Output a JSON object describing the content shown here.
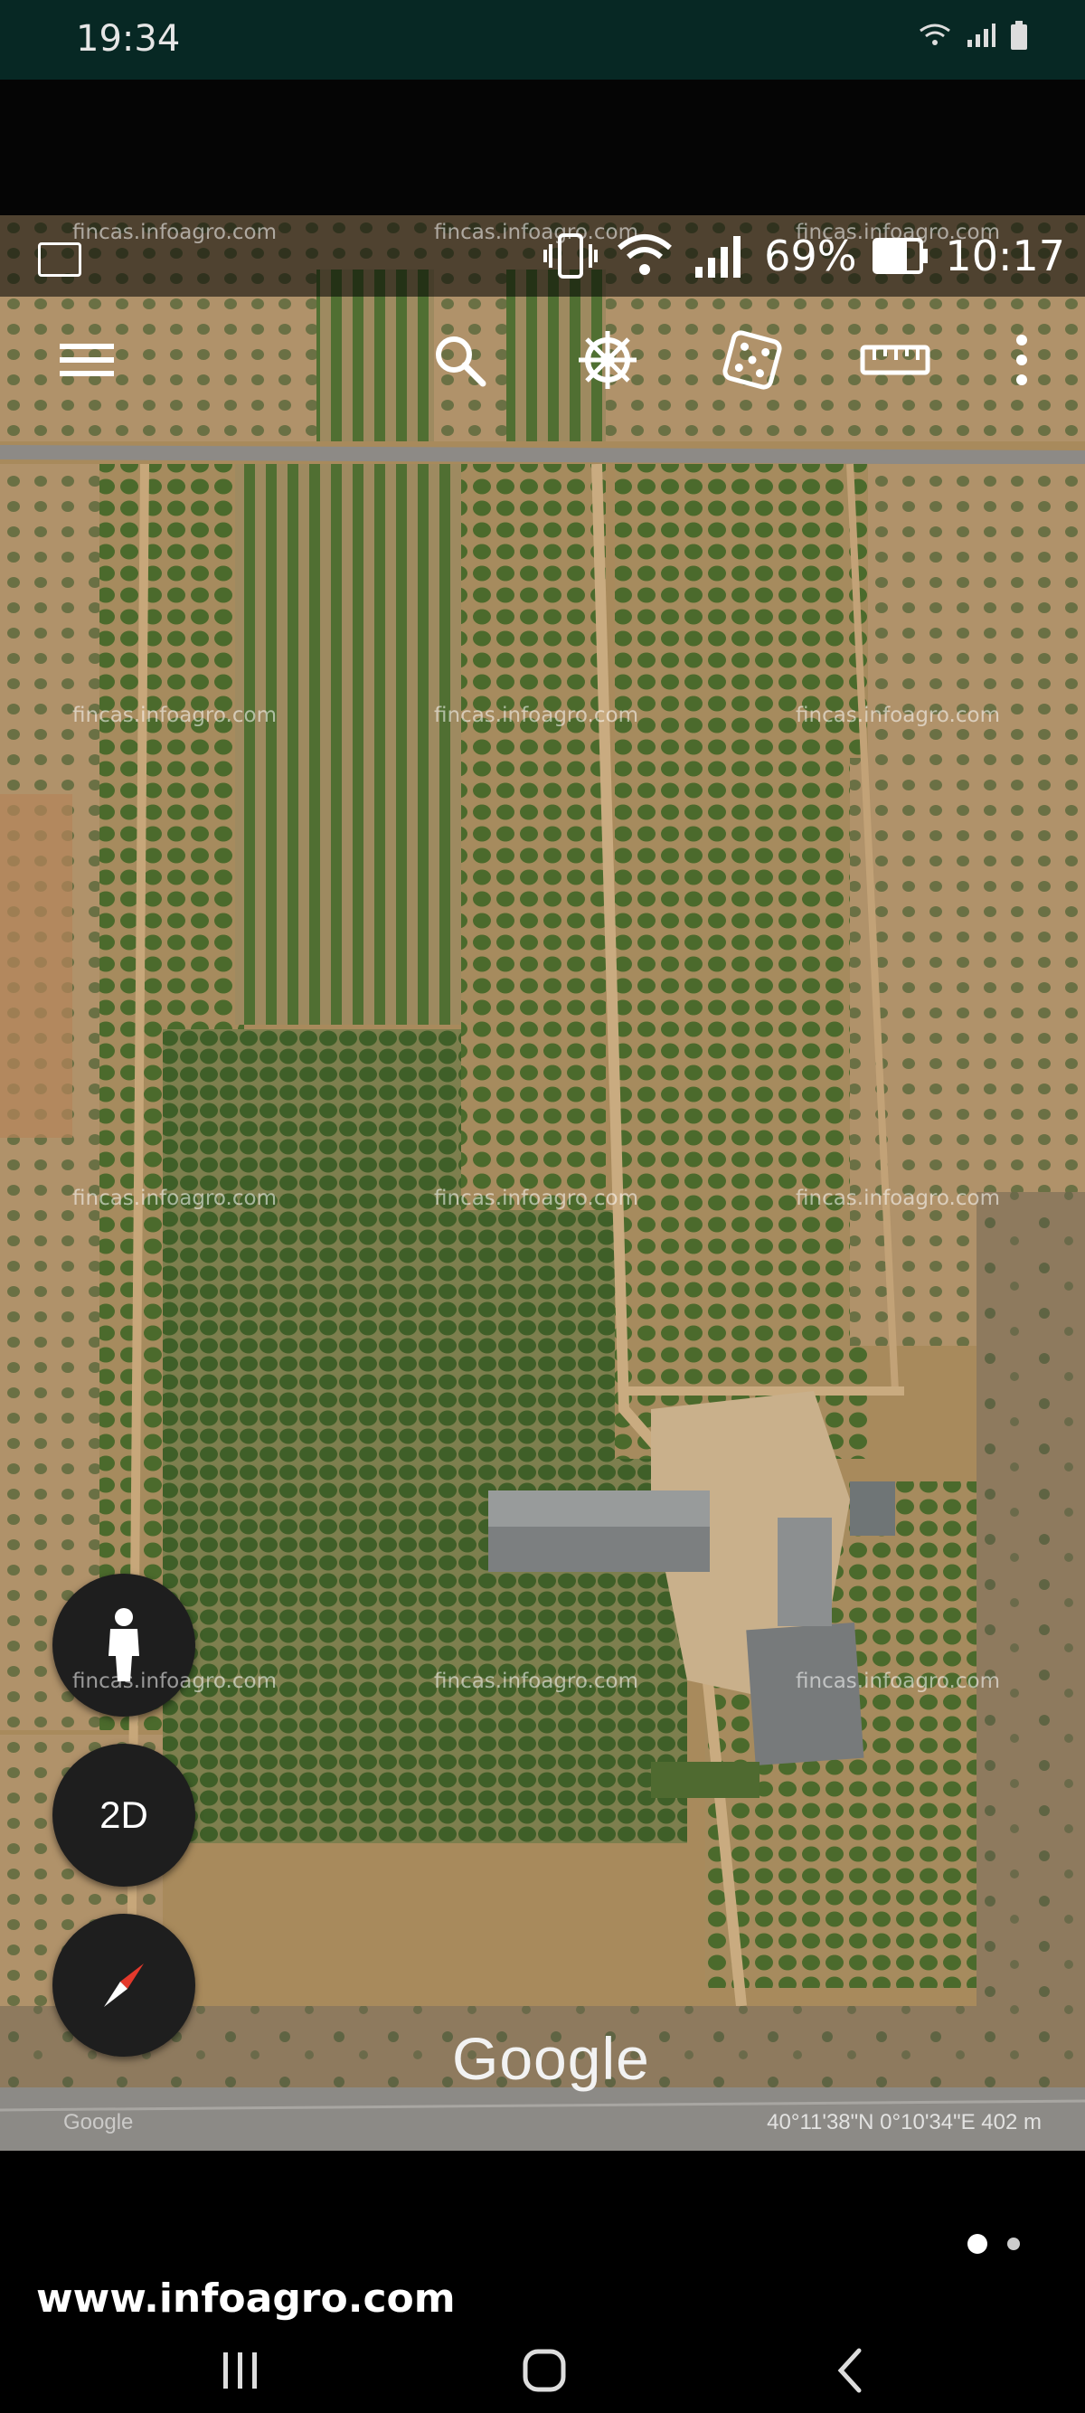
{
  "outer_status": {
    "time": "19:34"
  },
  "inner_status": {
    "battery": "69%",
    "time": "10:17"
  },
  "toolbar": {
    "items": [
      "menu-icon",
      "search-icon",
      "voyager-wheel-icon",
      "dice-icon",
      "ruler-icon",
      "more-vert-icon"
    ]
  },
  "map": {
    "fab_2d": "2D",
    "google_logo": "Google",
    "attribution": "Google",
    "coords": "40°11'38\"N 0°10'34\"E 402 m"
  },
  "watermark": {
    "text": "fincas.infoagro.com"
  },
  "bottom": {
    "site": "www.infoagro.com",
    "page_dots": 2,
    "nav": [
      "recents-icon",
      "home-icon",
      "back-icon"
    ]
  },
  "colors": {
    "status_bar": "#072824",
    "soil": "#a88a5c",
    "crop": "#4d6b2e",
    "fab": "#1e1e1e"
  }
}
